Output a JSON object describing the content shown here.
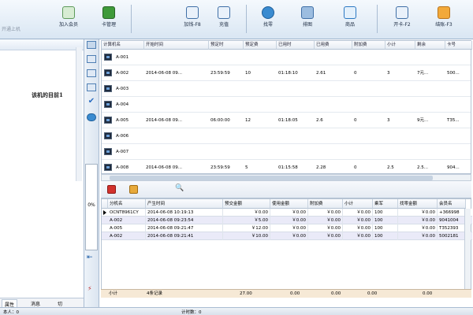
{
  "toolbar": {
    "offline_label": "开通上机",
    "buttons": [
      {
        "label": "加入会员",
        "icon": "add-member-icon"
      },
      {
        "label": "卡管理",
        "icon": "card-manage-icon"
      },
      {
        "label": "加钱-F8",
        "icon": "add-money-icon"
      },
      {
        "label": "充值",
        "icon": "recharge-icon"
      },
      {
        "label": "找零",
        "icon": "change-icon"
      },
      {
        "label": "排图",
        "icon": "chart-icon"
      },
      {
        "label": "商品",
        "icon": "cart-icon"
      },
      {
        "label": "开卡-F2",
        "icon": "open-card-icon"
      },
      {
        "label": "结账-F3",
        "icon": "checkout-folder-icon"
      }
    ]
  },
  "left_panel": {
    "ad_title": "该机的目前1",
    "progress_text": "0%",
    "tabs": [
      "属性",
      "消息",
      "切"
    ]
  },
  "terminals": {
    "headers": [
      "计算机名",
      "开始时间",
      "预定时",
      "预定费",
      "已用时",
      "已用费",
      "附加费",
      "小计",
      "剩余",
      "卡号"
    ],
    "rows": [
      [
        "A-001",
        "",
        "",
        "",
        "",
        "",
        "",
        "",
        "",
        ""
      ],
      [
        "A-002",
        "2014-06-08 09...",
        "23:59:59",
        "10",
        "01:18:10",
        "2.61",
        "0",
        "3",
        "7元...",
        "500..."
      ],
      [
        "A-003",
        "",
        "",
        "",
        "",
        "",
        "",
        "",
        "",
        ""
      ],
      [
        "A-004",
        "",
        "",
        "",
        "",
        "",
        "",
        "",
        "",
        ""
      ],
      [
        "A-005",
        "2014-06-08 09...",
        "06:00:00",
        "12",
        "01:18:05",
        "2.6",
        "0",
        "3",
        "9元...",
        "T35..."
      ],
      [
        "A-006",
        "",
        "",
        "",
        "",
        "",
        "",
        "",
        "",
        ""
      ],
      [
        "A-007",
        "",
        "",
        "",
        "",
        "",
        "",
        "",
        "",
        ""
      ],
      [
        "A-008",
        "2014-06-08 09...",
        "23:59:59",
        "5",
        "01:15:58",
        "2.28",
        "0",
        "2.5",
        "2.5...",
        "904..."
      ]
    ]
  },
  "records": {
    "headers": [
      "分机名",
      "产生时间",
      "预交金额",
      "使用金额",
      "附加费",
      "小计",
      "乘军",
      "找零金额",
      "会员名"
    ],
    "rows": [
      [
        "OCNT8961CY",
        "2014-06-08 10:19:13",
        "￥0.00",
        "￥0.00",
        "￥0.00",
        "￥0.00",
        "100",
        "￥0.00",
        "+366998"
      ],
      [
        "A-002",
        "2014-06-08 09:23:54",
        "￥5.00",
        "￥0.00",
        "￥0.00",
        "￥0.00",
        "100",
        "￥0.00",
        "9041004"
      ],
      [
        "A-005",
        "2014-06-08 09:21:47",
        "￥12.00",
        "￥0.00",
        "￥0.00",
        "￥0.00",
        "100",
        "￥0.00",
        "T352393"
      ],
      [
        "A-002",
        "2014-06-08 09:21:41",
        "￥10.00",
        "￥0.00",
        "￥0.00",
        "￥0.00",
        "100",
        "￥0.00",
        "5002181"
      ]
    ],
    "summary": {
      "label": "小计",
      "count": "4条记录",
      "deposit": "27.00",
      "used": "0.00",
      "extra": "0.00",
      "subtotal": "0.00",
      "change": "0.00"
    }
  },
  "statusbar": {
    "left": "本人：0",
    "middle": "计时数：0"
  },
  "colors": {
    "accent": "#1f5fa8",
    "grid_alt_row": "#eaeaf8",
    "summary_bg": "#f6e9d6"
  }
}
